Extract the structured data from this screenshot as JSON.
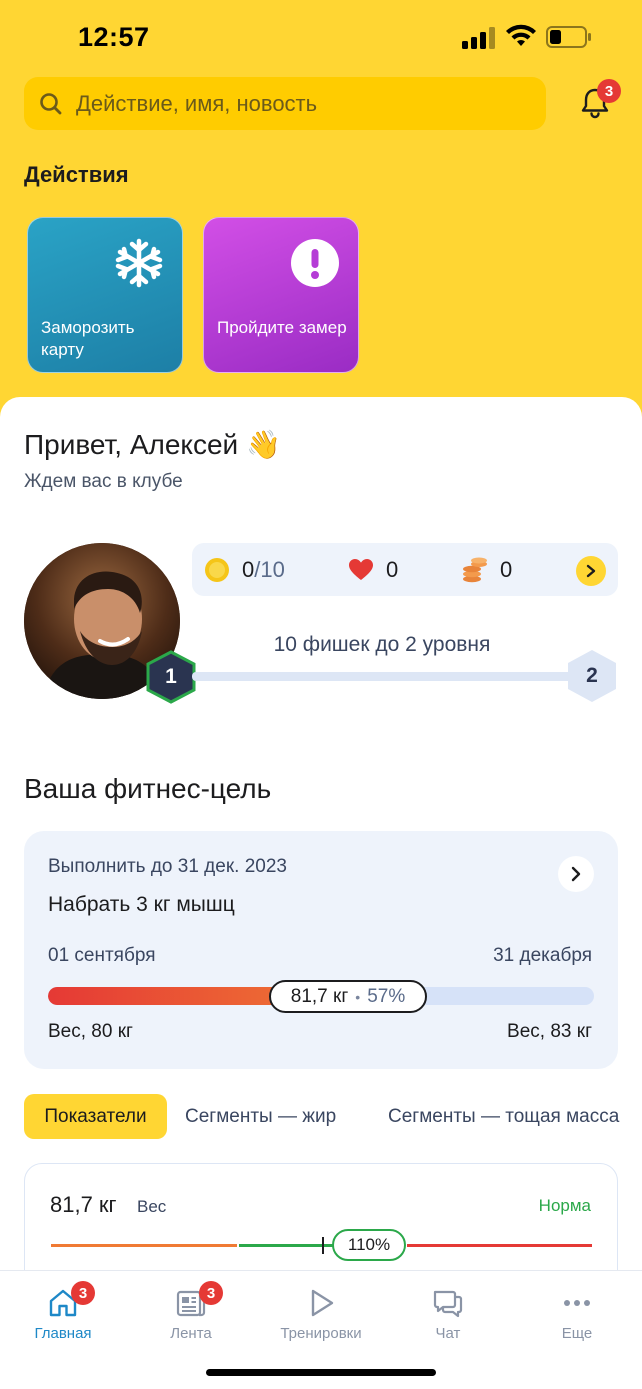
{
  "status_bar": {
    "time": "12:57"
  },
  "search": {
    "placeholder": "Действие, имя, новость",
    "icon": "search-icon"
  },
  "notifications": {
    "icon": "bell-icon",
    "count": "3"
  },
  "actions": {
    "title": "Действия",
    "tiles": [
      {
        "label": "Заморозить карту",
        "icon": "snowflake-icon",
        "color": "#2A9FC4"
      },
      {
        "label": "Пройдите замер",
        "icon": "exclamation-icon",
        "color": "#C043DD"
      }
    ]
  },
  "greeting": {
    "title": "Привет, Алексей",
    "emoji": "👋",
    "subtitle": "Ждем вас в клубе"
  },
  "profile": {
    "level": "1",
    "next_level": "2",
    "level_progress_text": "10 фишек до 2 уровня",
    "level_progress_fraction": 0,
    "stats": {
      "coins_value": "0",
      "coins_max": "/10",
      "hearts": "0",
      "stack": "0"
    }
  },
  "goal": {
    "section_title": "Ваша фитнес-цель",
    "deadline": "Выполнить до 31 дек. 2023",
    "name": "Набрать 3 кг мышц",
    "start_date": "01 сентября",
    "end_date": "31 декабря",
    "current_weight": "81,7 кг",
    "percent_text": "57%",
    "percent": 57,
    "start_weight": "Вес, 80 кг",
    "end_weight": "Вес, 83 кг"
  },
  "tabs": [
    {
      "label": "Показатели",
      "active": true
    },
    {
      "label": "Сегменты — жир",
      "active": false
    },
    {
      "label": "Сегменты — тощая масса",
      "active": false
    }
  ],
  "metric": {
    "value": "81,7 кг",
    "label": "Вес",
    "status": "Норма",
    "percent_text": "110%"
  },
  "tabbar": {
    "items": [
      {
        "label": "Главная",
        "icon": "home-icon",
        "badge": "3",
        "active": true
      },
      {
        "label": "Лента",
        "icon": "news-icon",
        "badge": "3",
        "active": false
      },
      {
        "label": "Тренировки",
        "icon": "play-icon",
        "badge": "",
        "active": false
      },
      {
        "label": "Чат",
        "icon": "chat-icon",
        "badge": "",
        "active": false
      },
      {
        "label": "Еще",
        "icon": "more-icon",
        "badge": "",
        "active": false
      }
    ]
  },
  "colors": {
    "accent_yellow": "#FFD633",
    "active_tab": "#1E88C7",
    "badge_red": "#E53935",
    "ok_green": "#2BA84A"
  }
}
